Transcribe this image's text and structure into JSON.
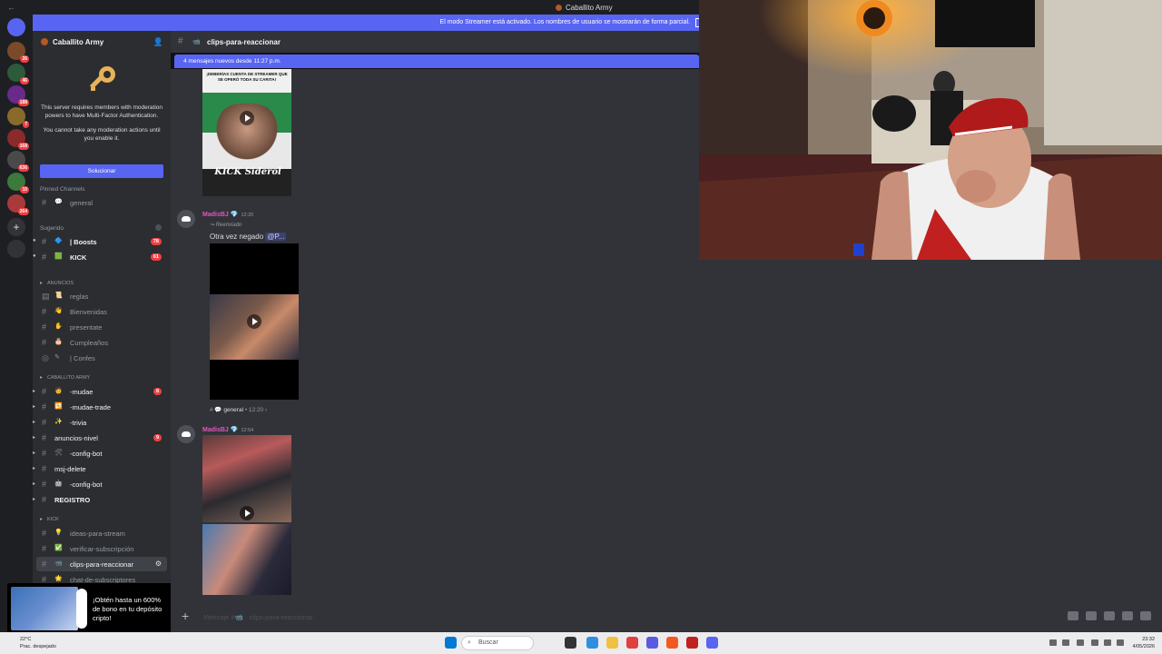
{
  "titlebar": {
    "title": "Caballito Army"
  },
  "streamer_banner": "El modo Streamer está activado. Los nombres de usuario se mostrarán de forma parcial.",
  "server_rail": {
    "badges": [
      "26",
      "46",
      "188",
      "7",
      "168",
      "636",
      "10",
      "264"
    ]
  },
  "sidebar": {
    "server_name": "Caballito Army",
    "mfa_text_1": "This server requires members with moderation powers to have Multi-Factor Authentication.",
    "mfa_text_2": "You cannot take any moderation actions until you enable it.",
    "fix_button": "Solucionar",
    "pinned_title": "Pinned Channels",
    "pinned": [
      {
        "label": "general"
      }
    ],
    "suggested_title": "Sugerido",
    "suggested": [
      {
        "label": "| Boosts",
        "count": "78"
      },
      {
        "label": "KICK",
        "count": "61"
      }
    ],
    "cat_anuncios": "ANUNCIOS",
    "anuncios": [
      {
        "label": "reglas"
      },
      {
        "label": "Bienvenidas"
      },
      {
        "label": "presentate"
      },
      {
        "label": "Cumpleaños"
      },
      {
        "label": "| Confes"
      }
    ],
    "cat_caballito": "CABALLITO ARMY",
    "caballito": [
      {
        "label": "-mudae",
        "count": "8"
      },
      {
        "label": "-mudae-trade"
      },
      {
        "label": "-trivia"
      },
      {
        "label": "anuncios-nivel",
        "count": "9"
      },
      {
        "label": "-config-bot"
      },
      {
        "label": "msj-delete"
      },
      {
        "label": "-config-bot"
      },
      {
        "label": "REGISTRO"
      }
    ],
    "cat_kick": "KICK",
    "kick": [
      {
        "label": "ideas-para-stream"
      },
      {
        "label": "verificar-subscripción"
      },
      {
        "label": "clips-para-reaccionar"
      },
      {
        "label": "chat-de-subscriptores"
      }
    ]
  },
  "ad": {
    "text": "¡Obtén hasta un 600% de bono en tu depósito cripto!"
  },
  "channel": {
    "name": "clips-para-reaccionar"
  },
  "new_messages": "4 mensajes nuevos desde 11:27 p.m.",
  "messages": [
    {
      "user": "MadisBJ",
      "time": "12:20",
      "forwarded": "Reenviado",
      "text": "Otra vez negado",
      "mention": "@P...",
      "source_channel": "general",
      "source_time": "12:20"
    },
    {
      "user": "MadisBJ",
      "time": "12:54"
    }
  ],
  "media_text": {
    "top_clip_caption": "¡DEBERÍAS CUENTA DE STREAMER QUE SE OPERÓ TODA SU CARITA!",
    "top_clip_brand": "KICK Siderol"
  },
  "composer": {
    "placeholder": "Mensaje #📹 · clips-para-reaccionar"
  },
  "taskbar": {
    "weather_temp": "22°C",
    "weather_desc": "Prac. despejado",
    "search": "Buscar",
    "time": "23:32",
    "date": "4/05/2026"
  },
  "colors": {
    "accent": "#5865f2",
    "username": "#e356bd",
    "unread_badge": "#f23f43"
  }
}
